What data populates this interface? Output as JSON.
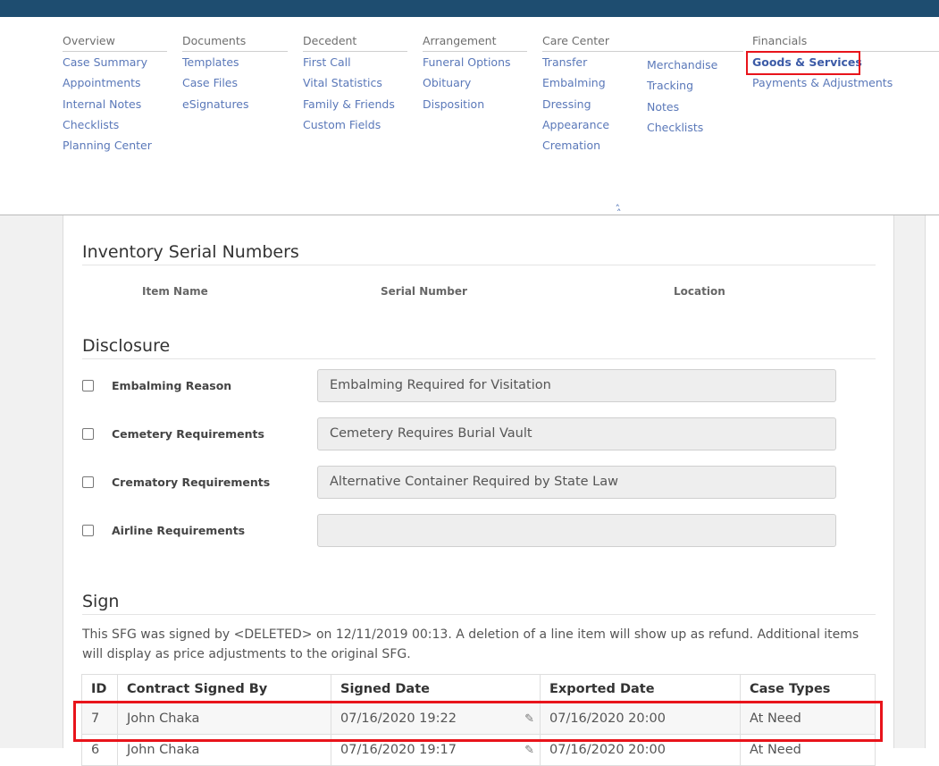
{
  "nav": {
    "columns": [
      {
        "heading": "Overview",
        "items": [
          "Case Summary",
          "Appointments",
          "Internal Notes",
          "Checklists",
          "Planning Center"
        ]
      },
      {
        "heading": "Documents",
        "items": [
          "Templates",
          "Case Files",
          "eSignatures"
        ]
      },
      {
        "heading": "Decedent",
        "items": [
          "First Call",
          "Vital Statistics",
          "Family & Friends",
          "Custom Fields"
        ]
      },
      {
        "heading": "Arrangement",
        "items": [
          "Funeral Options",
          "Obituary",
          "Disposition"
        ]
      },
      {
        "heading": "Care Center",
        "items": [
          "Transfer",
          "Embalming",
          "Dressing",
          "Appearance",
          "Cremation"
        ]
      },
      {
        "heading": "",
        "items": [
          "Merchandise",
          "Tracking",
          "Notes",
          "Checklists"
        ]
      },
      {
        "heading": "Financials",
        "items": [
          "Goods & Services",
          "Payments & Adjustments"
        ]
      }
    ],
    "active_item": "Goods & Services",
    "collapse_icon": "double-chevron-up-icon"
  },
  "inventory": {
    "title": "Inventory Serial Numbers",
    "columns": [
      "Item Name",
      "Serial Number",
      "Location"
    ]
  },
  "disclosure": {
    "title": "Disclosure",
    "rows": [
      {
        "label": "Embalming Reason",
        "checked": false,
        "value": "Embalming Required for Visitation"
      },
      {
        "label": "Cemetery Requirements",
        "checked": false,
        "value": "Cemetery Requires Burial Vault"
      },
      {
        "label": "Crematory Requirements",
        "checked": false,
        "value": "Alternative Container Required by State Law"
      },
      {
        "label": "Airline Requirements",
        "checked": false,
        "value": ""
      }
    ]
  },
  "sign": {
    "title": "Sign",
    "note": "This SFG was signed by <DELETED> on 12/11/2019 00:13. A deletion of a line item will show up as refund. Additional items will display as price adjustments to the original SFG.",
    "columns": [
      "ID",
      "Contract Signed By",
      "Signed Date",
      "Exported Date",
      "Case Types"
    ],
    "rows": [
      {
        "id": "7",
        "signed_by": "John Chaka",
        "signed_date": "07/16/2020 19:22",
        "exported_date": "07/16/2020 20:00",
        "case_type": "At Need"
      },
      {
        "id": "6",
        "signed_by": "John Chaka",
        "signed_date": "07/16/2020 19:17",
        "exported_date": "07/16/2020 20:00",
        "case_type": "At Need"
      }
    ]
  },
  "colors": {
    "topbar": "#1e4d70",
    "link": "#5a78b9",
    "highlight": "#e8141b"
  }
}
